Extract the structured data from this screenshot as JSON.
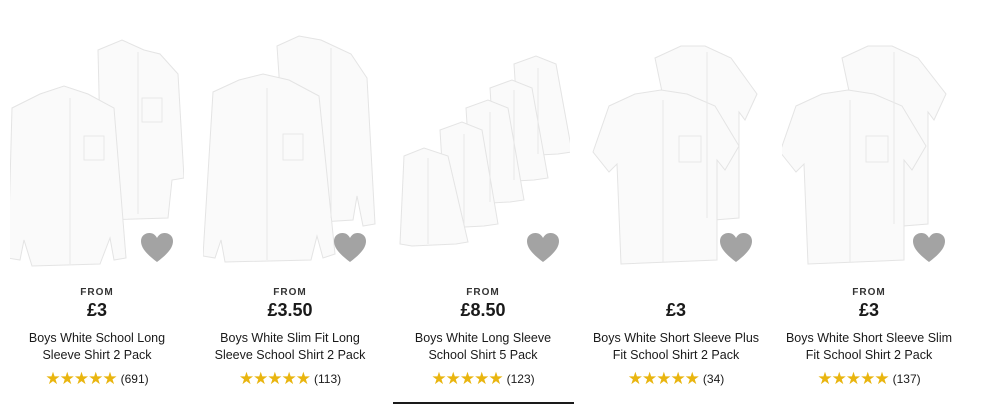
{
  "products": [
    {
      "from": "FROM",
      "price": "£3",
      "title": "Boys White School Long Sleeve Shirt 2 Pack",
      "stars": "★★★★★",
      "reviews": "(691)"
    },
    {
      "from": "FROM",
      "price": "£3.50",
      "title": "Boys White Slim Fit Long Sleeve School Shirt 2 Pack",
      "stars": "★★★★★",
      "reviews": "(113)"
    },
    {
      "from": "FROM",
      "price": "£8.50",
      "title": "Boys White Long Sleeve School Shirt 5 Pack",
      "stars": "★★★★★",
      "reviews": "(123)"
    },
    {
      "from": "",
      "price": "£3",
      "title": "Boys White Short Sleeve Plus Fit School Shirt 2 Pack",
      "stars": "★★★★★",
      "reviews": "(34)"
    },
    {
      "from": "FROM",
      "price": "£3",
      "title": "Boys White Short Sleeve Slim Fit School Shirt 2 Pack",
      "stars": "★★★★★",
      "reviews": "(137)"
    }
  ],
  "colors": {
    "star": "#e9b50f",
    "heart": "#a3a3a3",
    "text": "#1a1a1a"
  },
  "icons": {
    "wishlist": "heart-icon",
    "rating": "star-icon"
  }
}
